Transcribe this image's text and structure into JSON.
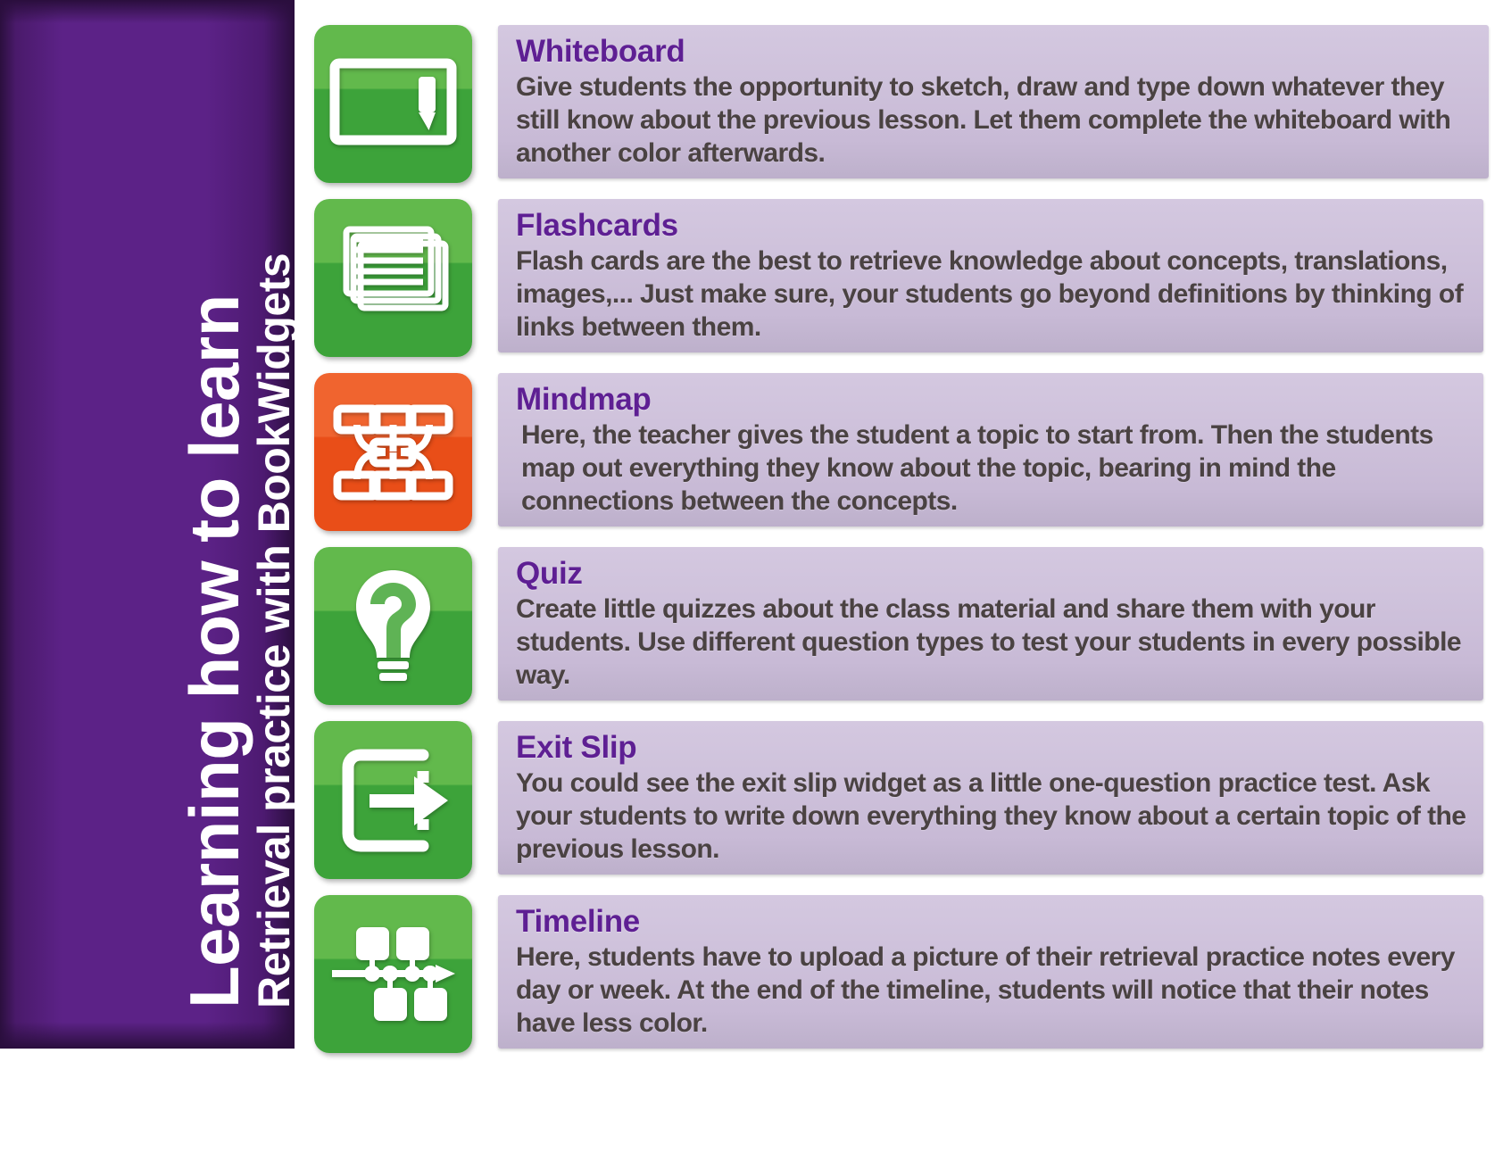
{
  "sidebar": {
    "title": "Learning how to learn",
    "subtitle": "Retrieval practice with BookWidgets",
    "bg_color": "#5c2287",
    "text_color": "#ffffff"
  },
  "theme": {
    "panel_bg": "#cdc0da",
    "title_color": "#5e1f93",
    "body_color": "#4a4242",
    "icon_green": "#3da33a",
    "icon_orange": "#e94e18"
  },
  "rows": [
    {
      "icon": "whiteboard-icon",
      "icon_color": "#3da33a",
      "title": "Whiteboard",
      "body": "Give students the opportunity to sketch, draw and type down whatever they still know about the previous lesson. Let them complete the whiteboard with another color afterwards."
    },
    {
      "icon": "flashcards-icon",
      "icon_color": "#3da33a",
      "title": "Flashcards",
      "body": "Flash cards are the best to retrieve knowledge about concepts, translations, images,... Just make sure, your students go beyond definitions by thinking of links between them."
    },
    {
      "icon": "mindmap-icon",
      "icon_color": "#e94e18",
      "title": "Mindmap",
      "body": "Here, the teacher gives the student a topic to start from. Then the students map out everything they know about the topic, bearing in mind the connections between the concepts."
    },
    {
      "icon": "quiz-lightbulb-icon",
      "icon_color": "#3da33a",
      "title": "Quiz",
      "body": "Create little quizzes about the class material and share them with your students. Use different question types to test your students in every possible way."
    },
    {
      "icon": "exit-slip-icon",
      "icon_color": "#3da33a",
      "title": "Exit Slip",
      "body": "You could see the exit slip widget as a little one-question practice test. Ask your students to write down everything they know about a certain topic of the previous lesson."
    },
    {
      "icon": "timeline-icon",
      "icon_color": "#3da33a",
      "title": "Timeline",
      "body": "Here, students have to upload a picture of their retrieval practice notes every day or week. At the end of the timeline, students will notice that their notes have less color."
    }
  ]
}
